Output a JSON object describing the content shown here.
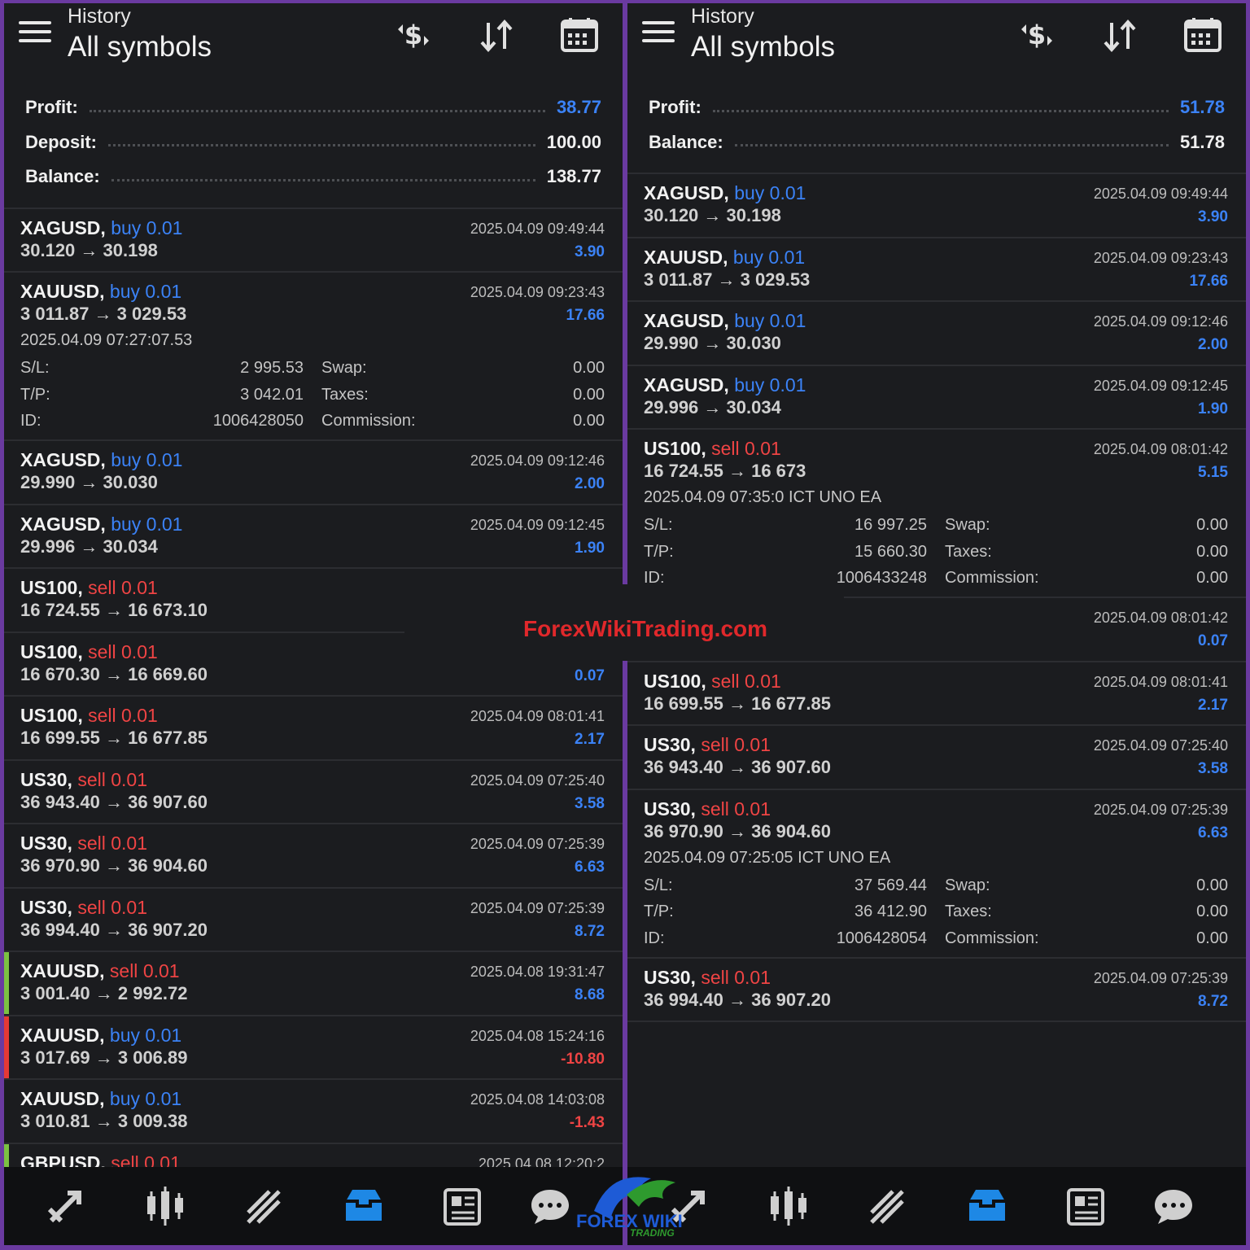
{
  "left": {
    "header": {
      "sub": "History",
      "title": "All symbols"
    },
    "summary": [
      {
        "label": "Profit:",
        "value": "38.77",
        "blue": true
      },
      {
        "label": "Deposit:",
        "value": "100.00",
        "blue": false
      },
      {
        "label": "Balance:",
        "value": "138.77",
        "blue": false
      }
    ],
    "deals": [
      {
        "symbol": "XAGUSD,",
        "side": "buy",
        "lot": "0.01",
        "prices": "30.120 → 30.198",
        "time": "2025.04.09 09:49:44",
        "profit": "3.90",
        "neg": false,
        "bar": ""
      },
      {
        "symbol": "XAUUSD,",
        "side": "buy",
        "lot": "0.01",
        "prices": "3 011.87 → 3 029.53",
        "time": "2025.04.09 09:23:43",
        "profit": "17.66",
        "neg": false,
        "bar": "",
        "expanded": {
          "open": "2025.04.09 07:27:07.53",
          "sl_label": "S/L:",
          "sl": "2 995.53",
          "swap_label": "Swap:",
          "swap": "0.00",
          "tp_label": "T/P:",
          "tp": "3 042.01",
          "taxes_label": "Taxes:",
          "taxes": "0.00",
          "id_label": "ID:",
          "id": "1006428050",
          "comm_label": "Commission:",
          "comm": "0.00"
        }
      },
      {
        "symbol": "XAGUSD,",
        "side": "buy",
        "lot": "0.01",
        "prices": "29.990 → 30.030",
        "time": "2025.04.09 09:12:46",
        "profit": "2.00",
        "neg": false,
        "bar": ""
      },
      {
        "symbol": "XAGUSD,",
        "side": "buy",
        "lot": "0.01",
        "prices": "29.996 → 30.034",
        "time": "2025.04.09 09:12:45",
        "profit": "1.90",
        "neg": false,
        "bar": ""
      },
      {
        "symbol": "US100,",
        "side": "sell",
        "lot": "0.01",
        "prices": "16 724.55 → 16 673.10",
        "time": "",
        "profit": "",
        "neg": false,
        "bar": ""
      },
      {
        "symbol": "US100,",
        "side": "sell",
        "lot": "0.01",
        "prices": "16 670.30 → 16 669.60",
        "time": "",
        "profit": "0.07",
        "neg": false,
        "bar": ""
      },
      {
        "symbol": "US100,",
        "side": "sell",
        "lot": "0.01",
        "prices": "16 699.55 → 16 677.85",
        "time": "2025.04.09 08:01:41",
        "profit": "2.17",
        "neg": false,
        "bar": ""
      },
      {
        "symbol": "US30,",
        "side": "sell",
        "lot": "0.01",
        "prices": "36 943.40 → 36 907.60",
        "time": "2025.04.09 07:25:40",
        "profit": "3.58",
        "neg": false,
        "bar": ""
      },
      {
        "symbol": "US30,",
        "side": "sell",
        "lot": "0.01",
        "prices": "36 970.90 → 36 904.60",
        "time": "2025.04.09 07:25:39",
        "profit": "6.63",
        "neg": false,
        "bar": ""
      },
      {
        "symbol": "US30,",
        "side": "sell",
        "lot": "0.01",
        "prices": "36 994.40 → 36 907.20",
        "time": "2025.04.09 07:25:39",
        "profit": "8.72",
        "neg": false,
        "bar": ""
      },
      {
        "symbol": "XAUUSD,",
        "side": "sell",
        "lot": "0.01",
        "prices": "3 001.40 → 2 992.72",
        "time": "2025.04.08 19:31:47",
        "profit": "8.68",
        "neg": false,
        "bar": "#7cc142"
      },
      {
        "symbol": "XAUUSD,",
        "side": "buy",
        "lot": "0.01",
        "prices": "3 017.69 → 3 006.89",
        "time": "2025.04.08 15:24:16",
        "profit": "-10.80",
        "neg": true,
        "bar": "#e53935"
      },
      {
        "symbol": "XAUUSD,",
        "side": "buy",
        "lot": "0.01",
        "prices": "3 010.81 → 3 009.38",
        "time": "2025.04.08 14:03:08",
        "profit": "-1.43",
        "neg": true,
        "bar": ""
      },
      {
        "symbol": "GBPUSD,",
        "side": "sell",
        "lot": "0.01",
        "prices": "",
        "time": "2025.04.08 12:20:2",
        "profit": "",
        "neg": false,
        "bar": "#7cc142"
      }
    ]
  },
  "right": {
    "header": {
      "sub": "History",
      "title": "All symbols"
    },
    "summary": [
      {
        "label": "Profit:",
        "value": "51.78",
        "blue": true
      },
      {
        "label": "Balance:",
        "value": "51.78",
        "blue": false
      }
    ],
    "deals": [
      {
        "symbol": "XAGUSD,",
        "side": "buy",
        "lot": "0.01",
        "prices": "30.120 → 30.198",
        "time": "2025.04.09 09:49:44",
        "profit": "3.90",
        "neg": false,
        "bar": ""
      },
      {
        "symbol": "XAUUSD,",
        "side": "buy",
        "lot": "0.01",
        "prices": "3 011.87 → 3 029.53",
        "time": "2025.04.09 09:23:43",
        "profit": "17.66",
        "neg": false,
        "bar": ""
      },
      {
        "symbol": "XAGUSD,",
        "side": "buy",
        "lot": "0.01",
        "prices": "29.990 → 30.030",
        "time": "2025.04.09 09:12:46",
        "profit": "2.00",
        "neg": false,
        "bar": ""
      },
      {
        "symbol": "XAGUSD,",
        "side": "buy",
        "lot": "0.01",
        "prices": "29.996 → 30.034",
        "time": "2025.04.09 09:12:45",
        "profit": "1.90",
        "neg": false,
        "bar": ""
      },
      {
        "symbol": "US100,",
        "side": "sell",
        "lot": "0.01",
        "prices": "16 724.55 → 16 673",
        "time": "2025.04.09 08:01:42",
        "profit": "5.15",
        "neg": false,
        "bar": "",
        "expanded": {
          "open": "2025.04.09 07:35:0 ICT UNO EA",
          "sl_label": "S/L:",
          "sl": "16 997.25",
          "swap_label": "Swap:",
          "swap": "0.00",
          "tp_label": "T/P:",
          "tp": "15 660.30",
          "taxes_label": "Taxes:",
          "taxes": "0.00",
          "id_label": "ID:",
          "id": "1006433248",
          "comm_label": "Commission:",
          "comm": "0.00"
        }
      },
      {
        "symbol": "",
        "side": "",
        "lot": "",
        "prices": "",
        "time": "2025.04.09 08:01:42",
        "profit": "0.07",
        "neg": false,
        "bar": ""
      },
      {
        "symbol": "US100,",
        "side": "sell",
        "lot": "0.01",
        "prices": "16 699.55 → 16 677.85",
        "time": "2025.04.09 08:01:41",
        "profit": "2.17",
        "neg": false,
        "bar": ""
      },
      {
        "symbol": "US30,",
        "side": "sell",
        "lot": "0.01",
        "prices": "36 943.40 → 36 907.60",
        "time": "2025.04.09 07:25:40",
        "profit": "3.58",
        "neg": false,
        "bar": ""
      },
      {
        "symbol": "US30,",
        "side": "sell",
        "lot": "0.01",
        "prices": "36 970.90 → 36 904.60",
        "time": "2025.04.09 07:25:39",
        "profit": "6.63",
        "neg": false,
        "bar": "",
        "expanded": {
          "open": "2025.04.09 07:25:05 ICT UNO EA",
          "sl_label": "S/L:",
          "sl": "37 569.44",
          "swap_label": "Swap:",
          "swap": "0.00",
          "tp_label": "T/P:",
          "tp": "36 412.90",
          "taxes_label": "Taxes:",
          "taxes": "0.00",
          "id_label": "ID:",
          "id": "1006428054",
          "comm_label": "Commission:",
          "comm": "0.00"
        }
      },
      {
        "symbol": "US30,",
        "side": "sell",
        "lot": "0.01",
        "prices": "36 994.40 → 36 907.20",
        "time": "2025.04.09 07:25:39",
        "profit": "8.72",
        "neg": false,
        "bar": ""
      }
    ]
  },
  "nav_icons": [
    "quotes-icon",
    "chart-icon",
    "trade-icon",
    "history-icon",
    "news-icon",
    "messages-icon"
  ],
  "colors": {
    "background": "#1b1c1f",
    "blue": "#3b82f6",
    "red": "#ef4444",
    "nav_active": "#1e88e5",
    "frame": "#6a3aa0"
  },
  "watermark": "ForexWikiTrading.com",
  "logo": {
    "main": "FOREX WIKI",
    "sub": "TRADING"
  }
}
